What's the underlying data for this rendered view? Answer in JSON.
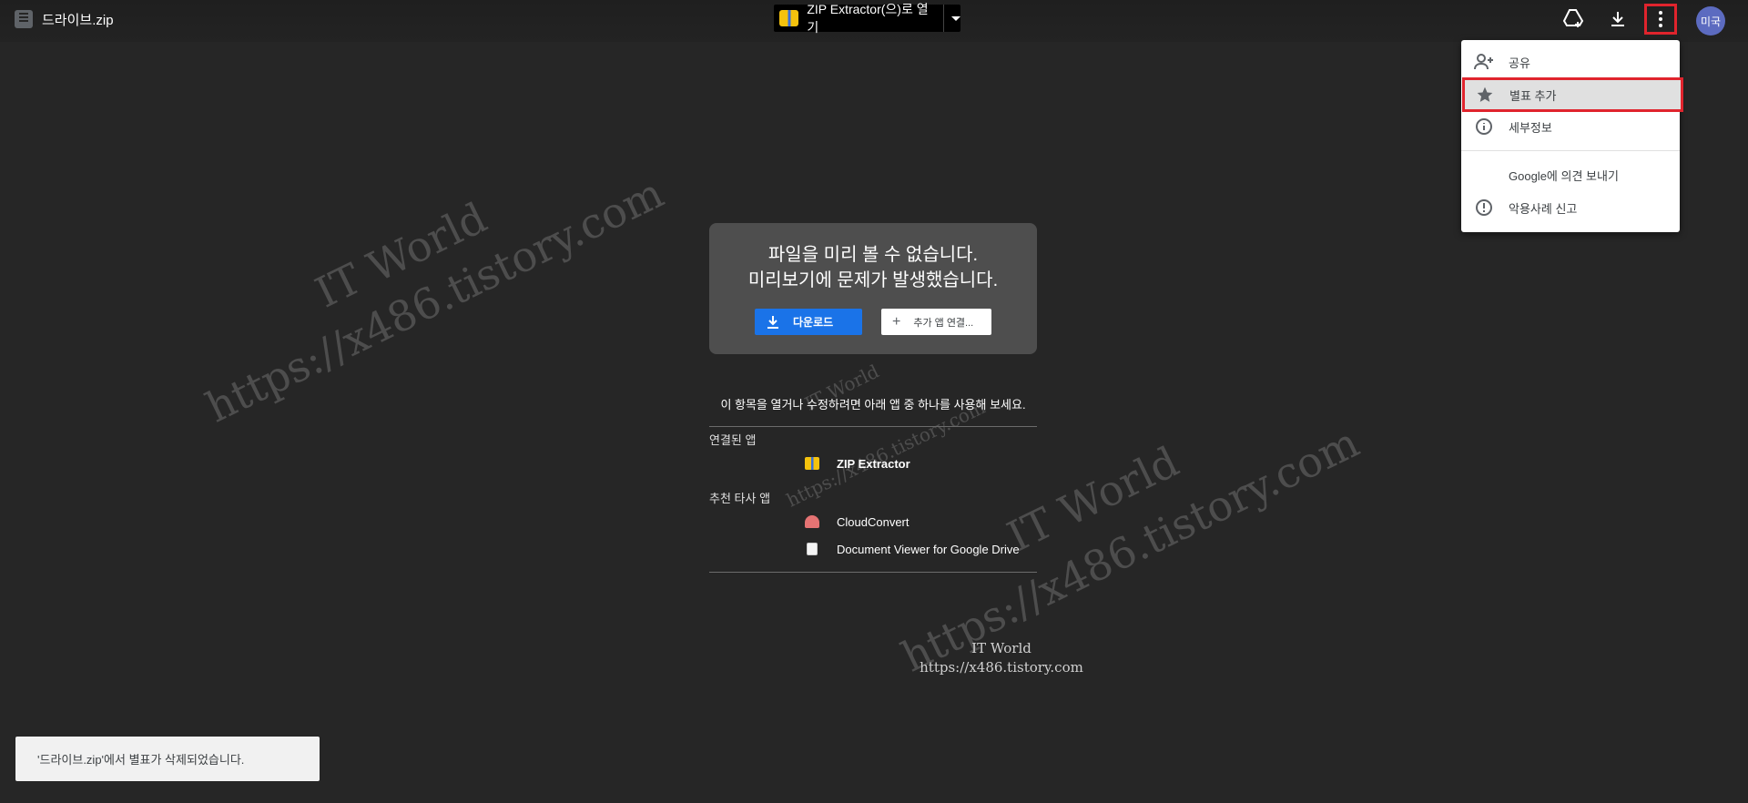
{
  "topbar": {
    "file_title": "드라이브.zip",
    "open_with_label": "ZIP Extractor(으)로 열기",
    "avatar_text": "미국"
  },
  "menu": {
    "items": [
      {
        "label": "공유",
        "icon": "person-add-icon"
      },
      {
        "label": "별표 추가",
        "icon": "star-icon"
      },
      {
        "label": "세부정보",
        "icon": "info-icon"
      },
      {
        "label": "Google에 의견 보내기",
        "icon": ""
      },
      {
        "label": "악용사례 신고",
        "icon": "report-icon"
      }
    ]
  },
  "card": {
    "line1": "파일을 미리 볼 수 없습니다.",
    "line2": "미리보기에 문제가 발생했습니다.",
    "download_label": "다운로드",
    "connect_label": "추가 앱 연결..."
  },
  "apps": {
    "hint": "이 항목을 열거나 수정하려면 아래 앱 중 하나를 사용해 보세요.",
    "connected_label": "연결된 앱",
    "connected": [
      "ZIP Extractor"
    ],
    "recommended_label": "추천 타사 앱",
    "recommended": [
      "CloudConvert",
      "Document Viewer for Google Drive"
    ]
  },
  "watermark": {
    "title": "IT World",
    "url": "https://x486.tistory.com"
  },
  "toast": {
    "message": "'드라이브.zip'에서 별표가 삭제되었습니다."
  },
  "colors": {
    "highlight_border": "#e0242d",
    "primary_button": "#1a73e8",
    "background": "#262626"
  }
}
